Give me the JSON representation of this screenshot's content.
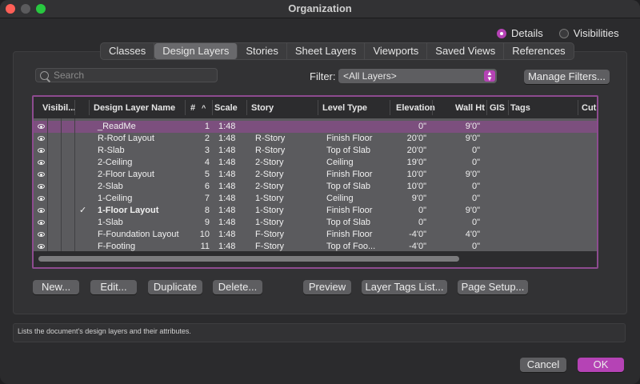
{
  "window": {
    "title": "Organization"
  },
  "view_mode": {
    "options": [
      "Details",
      "Visibilities"
    ],
    "selected": "Details"
  },
  "tabs": [
    "Classes",
    "Design Layers",
    "Stories",
    "Sheet Layers",
    "Viewports",
    "Saved Views",
    "References"
  ],
  "active_tab": "Design Layers",
  "search": {
    "placeholder": "Search",
    "value": ""
  },
  "filter": {
    "label": "Filter:",
    "value": "<All Layers>",
    "manage_label": "Manage Filters..."
  },
  "table": {
    "columns": [
      "Visibil...",
      "Design Layer Name",
      "#",
      "Scale",
      "Story",
      "Level Type",
      "Elevation",
      "Wall Ht",
      "GIS",
      "Tags",
      "Cut"
    ],
    "sort_column": "#",
    "rows": [
      {
        "name": "_ReadMe",
        "num": "1",
        "scale": "1:48",
        "story": "",
        "level": "",
        "elev": "0\"",
        "wall": "9'0\"",
        "selected": true,
        "active": false
      },
      {
        "name": "R-Roof Layout",
        "num": "2",
        "scale": "1:48",
        "story": "R-Story",
        "level": "Finish Floor",
        "elev": "20'0\"",
        "wall": "9'0\"",
        "selected": false,
        "active": false
      },
      {
        "name": "R-Slab",
        "num": "3",
        "scale": "1:48",
        "story": "R-Story",
        "level": "Top of Slab",
        "elev": "20'0\"",
        "wall": "0\"",
        "selected": false,
        "active": false
      },
      {
        "name": "2-Ceiling",
        "num": "4",
        "scale": "1:48",
        "story": "2-Story",
        "level": "Ceiling",
        "elev": "19'0\"",
        "wall": "0\"",
        "selected": false,
        "active": false
      },
      {
        "name": "2-Floor Layout",
        "num": "5",
        "scale": "1:48",
        "story": "2-Story",
        "level": "Finish Floor",
        "elev": "10'0\"",
        "wall": "9'0\"",
        "selected": false,
        "active": false
      },
      {
        "name": "2-Slab",
        "num": "6",
        "scale": "1:48",
        "story": "2-Story",
        "level": "Top of Slab",
        "elev": "10'0\"",
        "wall": "0\"",
        "selected": false,
        "active": false
      },
      {
        "name": "1-Ceiling",
        "num": "7",
        "scale": "1:48",
        "story": "1-Story",
        "level": "Ceiling",
        "elev": "9'0\"",
        "wall": "0\"",
        "selected": false,
        "active": false
      },
      {
        "name": "1-Floor Layout",
        "num": "8",
        "scale": "1:48",
        "story": "1-Story",
        "level": "Finish Floor",
        "elev": "0\"",
        "wall": "9'0\"",
        "selected": false,
        "active": true
      },
      {
        "name": "1-Slab",
        "num": "9",
        "scale": "1:48",
        "story": "1-Story",
        "level": "Top of Slab",
        "elev": "0\"",
        "wall": "0\"",
        "selected": false,
        "active": false
      },
      {
        "name": "F-Foundation Layout",
        "num": "10",
        "scale": "1:48",
        "story": "F-Story",
        "level": "Finish Floor",
        "elev": "-4'0\"",
        "wall": "4'0\"",
        "selected": false,
        "active": false
      },
      {
        "name": "F-Footing",
        "num": "11",
        "scale": "1:48",
        "story": "F-Story",
        "level": "Top of Foo...",
        "elev": "-4'0\"",
        "wall": "0\"",
        "selected": false,
        "active": false
      }
    ]
  },
  "buttons": {
    "new": "New...",
    "edit": "Edit...",
    "duplicate": "Duplicate",
    "delete": "Delete...",
    "preview": "Preview",
    "layer_tags": "Layer Tags List...",
    "page_setup": "Page Setup...",
    "cancel": "Cancel",
    "ok": "OK"
  },
  "status_text": "Lists the document's design layers and their attributes.",
  "colors": {
    "accent": "#b543b5",
    "selected_row": "#7c4f7e",
    "table_bg": "#5b5b5e"
  }
}
